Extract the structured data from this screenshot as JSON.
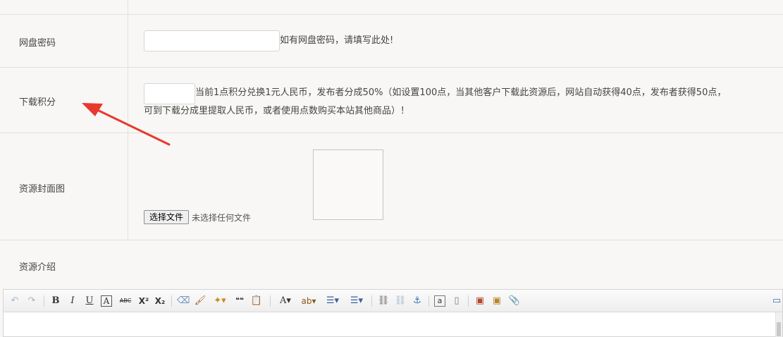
{
  "form": {
    "pan_password": {
      "label": "网盘密码",
      "value": "",
      "hint": "如有网盘密码，请填写此处!"
    },
    "download_points": {
      "label": "下载积分",
      "value": "",
      "hint_line1": "当前1点积分兑换1元人民币，发布者分成50%（如设置100点，当其他客户下载此资源后，网站自动获得40点，发布者获得50点，",
      "hint_line2": "可到下载分成里提取人民币，或者使用点数购买本站其他商品）！"
    },
    "cover_image": {
      "label": "资源封面图",
      "file_button": "选择文件",
      "file_status": "未选择任何文件"
    },
    "description": {
      "label": "资源介绍"
    }
  },
  "annotation": {
    "arrow_color": "#e8392f"
  },
  "editor_toolbar": {
    "undo": "↶",
    "redo": "↷",
    "bold": "B",
    "italic": "I",
    "underline": "U",
    "font_border": "A",
    "strikethrough": "ABC",
    "superscript": "X²",
    "subscript": "X₂",
    "eraser": "⌫",
    "format_painter": "🖌",
    "auto_format": "✦▾",
    "quote": "❝❝",
    "paste_plain": "📋",
    "font_color": "A▾",
    "background_color": "ab▾",
    "ordered_list": "☰▾",
    "unordered_list": "☰▾",
    "link": "⛓",
    "unlink": "⛓",
    "anchor": "⚓",
    "amazon": "a",
    "page": "▯",
    "image": "▣",
    "multi_image": "▣",
    "attachment": "📎",
    "fullscreen": "▭"
  }
}
